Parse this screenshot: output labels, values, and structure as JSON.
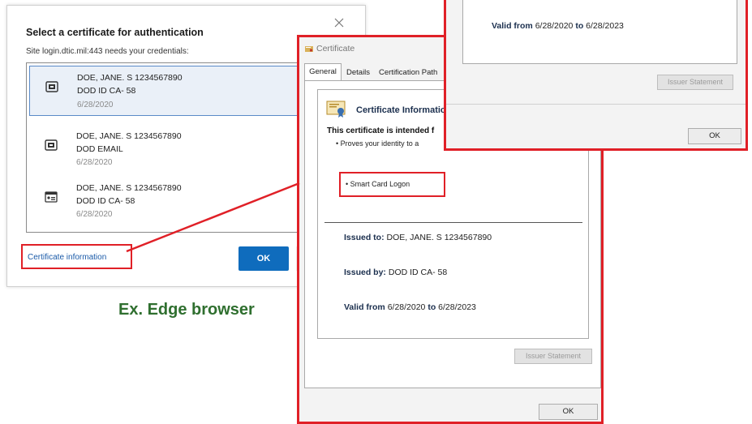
{
  "edge_dialog": {
    "title": "Select a certificate for authentication",
    "site_text": "Site login.dtic.mil:443 needs your credentials:",
    "certificates": [
      {
        "name": "DOE, JANE. S 1234567890",
        "issuer": "DOD ID CA- 58",
        "date": "6/28/2020",
        "icon": "smart-card-icon"
      },
      {
        "name": "DOE, JANE. S 1234567890",
        "issuer": "DOD EMAIL",
        "date": "6/28/2020",
        "icon": "smart-card-icon"
      },
      {
        "name": "DOE, JANE. S 1234567890",
        "issuer": "DOD ID CA- 58",
        "date": "6/28/2020",
        "icon": "id-card-icon"
      }
    ],
    "cert_info_link": "Certificate information",
    "ok_label": "OK",
    "close_icon": "close-icon"
  },
  "caption": "Ex. Edge browser",
  "cert_window": {
    "title": "Certificate",
    "tabs": [
      "General",
      "Details",
      "Certification Path"
    ],
    "info_title": "Certificate Informatio",
    "intended_text": "This certificate is intended f",
    "purpose_1": "• Proves your identity to a",
    "purpose_2": "• Smart Card Logon",
    "issued_to_label": "Issued to:",
    "issued_to_value": "DOE, JANE. S 1234567890",
    "issued_by_label": "Issued by:",
    "issued_by_value": "DOD ID CA- 58",
    "valid_from_label": "Valid from",
    "valid_from_value": "6/28/2020",
    "valid_to_label": "to",
    "valid_to_value": "6/28/2023",
    "issuer_statement": "Issuer Statement",
    "ok_label": "OK"
  },
  "cert_window_top": {
    "valid_from_label": "Valid from",
    "valid_from_value": "6/28/2020",
    "valid_to_label": "to",
    "valid_to_value": "6/28/2023",
    "issuer_statement": "Issuer Statement",
    "ok_label": "OK"
  },
  "colors": {
    "highlight_red": "#e02027",
    "edge_blue": "#0f6cbd",
    "caption_green": "#2f6f2f"
  }
}
